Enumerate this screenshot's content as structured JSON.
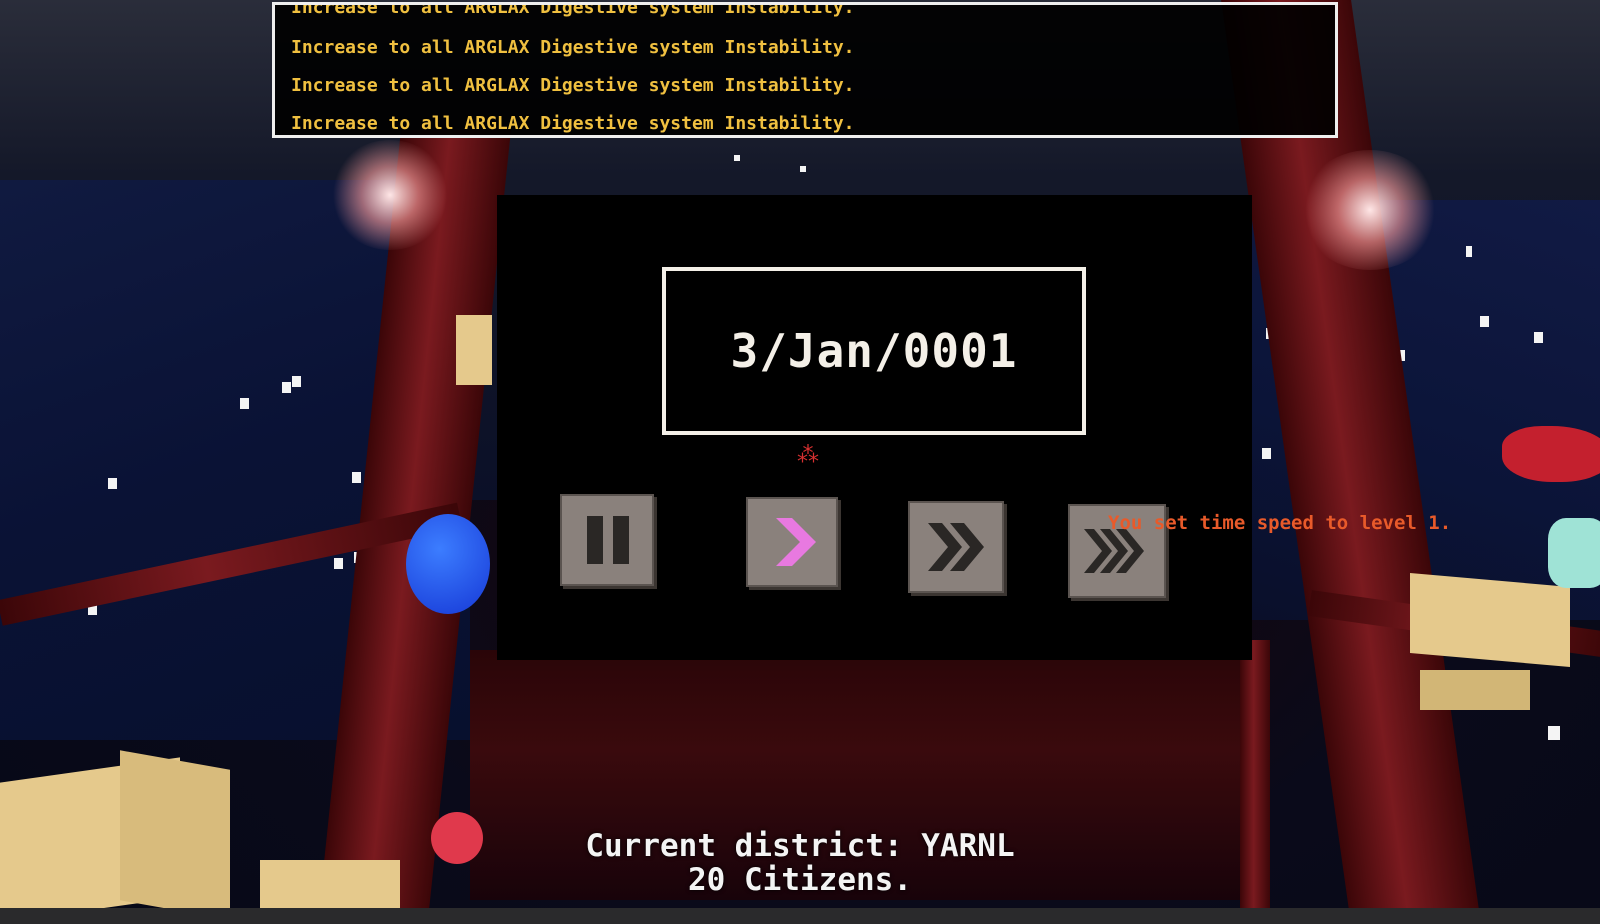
{
  "event_log": {
    "lines": [
      "Increase to all ARGLAX Digestive system Instability.",
      "Increase to all ARGLAX Digestive system Instability.",
      "Increase to all ARGLAX Digestive system Instability.",
      "Increase to all ARGLAX Digestive system Instability."
    ],
    "text_color": "#f0c040"
  },
  "time_control": {
    "date": "3/Jan/0001",
    "speeds": [
      {
        "name": "pause",
        "icon": "pause-icon",
        "active": false
      },
      {
        "name": "speed-1",
        "icon": "single-chevron-icon",
        "active": true,
        "accent": "#e879e0"
      },
      {
        "name": "speed-2",
        "icon": "double-chevron-icon",
        "active": false
      },
      {
        "name": "speed-3",
        "icon": "triple-chevron-icon",
        "active": false
      }
    ]
  },
  "notification": {
    "text": "You set time speed to level 1.",
    "color": "#e85a2a"
  },
  "district_info": {
    "line1": "Current district: YARNL",
    "line2": "20 Citizens."
  }
}
